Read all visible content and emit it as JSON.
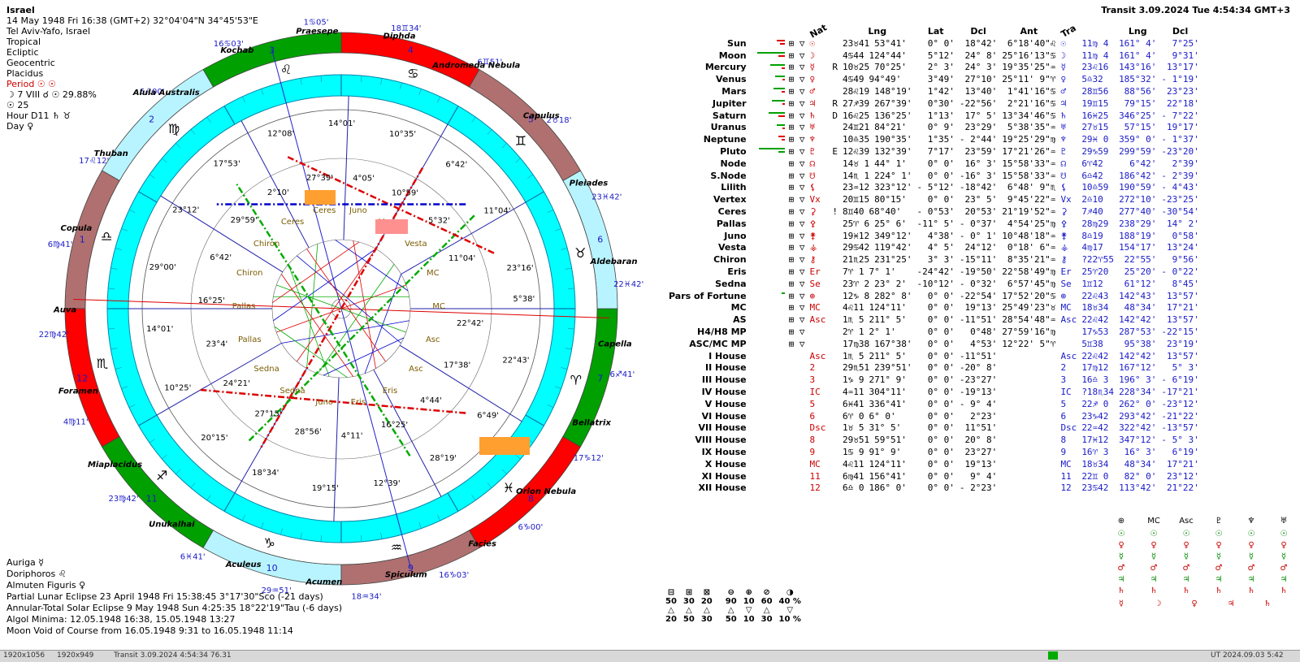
{
  "info": {
    "place": "Israel",
    "datetime": "14 May 1948  Fri  16:38 (GMT+2) 32°04'04\"N  34°45'53\"E",
    "city": "Tel Aviv-Yafo, Israel",
    "zodiac": "Tropical",
    "coords": "Ecliptic",
    "center": "Geocentric",
    "houses": "Placidus",
    "period": "Period  ☉ ☉",
    "moon_phase": "☽  7 VIII ☌ ☉ 29.88%",
    "day_num": "☉  25",
    "hour": "Hour D11  ♄ ♉",
    "day": "Day  ♀"
  },
  "transit": {
    "label": "Transit  3.09.2024   Tue   4:54:34 GMT+3"
  },
  "chart_labels": {
    "house_numbers": [
      "1",
      "2",
      "3",
      "4",
      "5",
      "6",
      "7",
      "8",
      "9",
      "10",
      "11",
      "12"
    ],
    "cusps": [
      "22♓42'",
      "23♓42'",
      "2♉18'",
      "6♊51'",
      "18♊34'",
      "1♋05'",
      "16♋03'",
      "6♌00'",
      "17♌12'",
      "6♍41'",
      "22♍42'",
      "4♍11'",
      "23♍42'",
      "6♓41'",
      "29♒51'",
      "18♒34'",
      "16♑03'",
      "6♑00'",
      "17♑12'",
      "6♐41'"
    ],
    "stars": [
      "Praesepe",
      "Kochab",
      "Alula Australis",
      "Thuban",
      "Copula",
      "Auva",
      "Foramen",
      "Miaplacidus",
      "Unukalhai",
      "Aculeus",
      "Acumen",
      "Spiculum",
      "Facies",
      "Orion Nebula",
      "Bellatrix",
      "Capella",
      "Aldebaran",
      "Pleiades",
      "Capulus",
      "Andromeda Nebula",
      "Diphda"
    ],
    "planet_labels": [
      "23°16'",
      "11°04'",
      "11°04'",
      "5°32'",
      "6°42'",
      "10°59'",
      "10°35'",
      "4°05'",
      "14°01'",
      "27°39'",
      "12°08'",
      "2°10'",
      "17°53'",
      "29°59'",
      "23°12'",
      "6°42'",
      "29°00'",
      "16°25'",
      "14°01'",
      "23°4'",
      "10°25'",
      "24°21'",
      "20°15'",
      "27°15'",
      "18°34'",
      "28°56'",
      "19°15'",
      "4°11'",
      "12°39'",
      "16°25'",
      "28°19'",
      "4°44'",
      "6°49'",
      "17°38'",
      "22°43'",
      "22°42'",
      "5°38'"
    ],
    "point_names": [
      "Vesta",
      "Vesta",
      "Juno",
      "Ceres",
      "Ceres",
      "Chiron",
      "Chiron",
      "Pallas",
      "Pallas",
      "Sedna",
      "Sedna",
      "Juno",
      "Eris",
      "Eris",
      "Asc",
      "Asc",
      "MC",
      "MC"
    ]
  },
  "table_headers": {
    "nat": "Nat",
    "lng": "Lng",
    "lat": "Lat",
    "dcl": "Dcl",
    "ant": "Ant",
    "tra": "Tra",
    "tlng": "Lng",
    "tdcl": "Dcl"
  },
  "rows": [
    {
      "name": "Sun",
      "sym": "☉",
      "flag": "",
      "lng": "23♉41",
      "lngd": "53°41'",
      "lat": "0° 0'",
      "dcl": "18°42'",
      "ant": "6°18'40\"♌",
      "tsym": "☉",
      "tra": "11♍ 4",
      "tlng": "161° 4'",
      "tdcl": "7°25'",
      "bars": [
        [
          "#e00000",
          10
        ],
        [
          "#e00000",
          6
        ]
      ]
    },
    {
      "name": "Moon",
      "sym": "☽",
      "flag": "",
      "lng": "4♋44",
      "lngd": "124°44'",
      "lat": "5°12'",
      "dcl": "24° 8'",
      "ant": "25°16'13\"♋",
      "tsym": "☽",
      "tra": "11♍ 4",
      "tlng": "161° 4'",
      "tdcl": "9°31'",
      "bars": [
        [
          "#00a000",
          34
        ],
        [
          "#e00000",
          8
        ]
      ]
    },
    {
      "name": "Mercury",
      "sym": "☿",
      "flag": "R",
      "lng": "10♉25",
      "lngd": "70°25'",
      "lat": "2° 3'",
      "dcl": "24° 3'",
      "ant": "19°35'25\"♒",
      "tsym": "☿",
      "tra": "23♌16",
      "tlng": "143°16'",
      "tdcl": "13°17'",
      "bars": [
        [
          "#00a000",
          18
        ],
        [
          "#e00000",
          4
        ]
      ]
    },
    {
      "name": "Venus",
      "sym": "♀",
      "flag": "",
      "lng": "4♋49",
      "lngd": "94°49'",
      "lat": "3°49'",
      "dcl": "27°10'",
      "ant": "25°11' 9\"♈",
      "tsym": "♀",
      "tra": "5♎32",
      "tlng": "185°32'",
      "tdcl": "- 1°19'",
      "bars": [
        [
          "#00a000",
          12
        ],
        [
          "#e00000",
          3
        ]
      ]
    },
    {
      "name": "Mars",
      "sym": "♂",
      "flag": "",
      "lng": "28♌19",
      "lngd": "148°19'",
      "lat": "1°42'",
      "dcl": "13°40'",
      "ant": "1°41'16\"♋",
      "tsym": "♂",
      "tra": "28♊56",
      "tlng": "88°56'",
      "tdcl": "23°23'",
      "bars": [
        [
          "#00a000",
          14
        ],
        [
          "#e00000",
          4
        ]
      ]
    },
    {
      "name": "Jupiter",
      "sym": "♃",
      "flag": "R",
      "lng": "27♐39",
      "lngd": "267°39'",
      "lat": "0°30'",
      "dcl": "-22°56'",
      "ant": "2°21'16\"♋",
      "tsym": "♃",
      "tra": "19♊15",
      "tlng": "79°15'",
      "tdcl": "22°18'",
      "bars": [
        [
          "#00a000",
          16
        ],
        [
          "#e00000",
          3
        ]
      ]
    },
    {
      "name": "Saturn",
      "sym": "♄",
      "flag": "D",
      "lng": "16♌25",
      "lngd": "136°25'",
      "lat": "1°13'",
      "dcl": "17° 5'",
      "ant": "13°34'46\"♋",
      "tsym": "♄",
      "tra": "16♓25",
      "tlng": "346°25'",
      "tdcl": "- 7°22'",
      "bars": [
        [
          "#00a000",
          20
        ],
        [
          "#e00000",
          8
        ]
      ]
    },
    {
      "name": "Uranus",
      "sym": "♅",
      "flag": "",
      "lng": "24♊21",
      "lngd": "84°21'",
      "lat": "0° 9'",
      "dcl": "23°29'",
      "ant": "5°38'35\"♒",
      "tsym": "♅",
      "tra": "27♉15",
      "tlng": "57°15'",
      "tdcl": "19°17'",
      "bars": [
        [
          "#00a000",
          10
        ],
        [
          "#e00000",
          3
        ]
      ]
    },
    {
      "name": "Neptune",
      "sym": "♆",
      "flag": "",
      "lng": "10♎35",
      "lngd": "190°35'",
      "lat": "1°35'",
      "dcl": "- 2°44'",
      "ant": "19°25'29\"♍",
      "tsym": "♆",
      "tra": "29♓ 0",
      "tlng": "359° 0'",
      "tdcl": "- 1°37'",
      "bars": [
        [
          "#e00000",
          8
        ],
        [
          "#e00000",
          4
        ]
      ]
    },
    {
      "name": "Pluto",
      "sym": "♇",
      "flag": "E",
      "lng": "12♌39",
      "lngd": "132°39'",
      "lat": "7°17'",
      "dcl": "23°59'",
      "ant": "17°21'26\"♒",
      "tsym": "♇",
      "tra": "29♑59",
      "tlng": "299°59'",
      "tdcl": "-23°20'",
      "bars": [
        [
          "#00a000",
          32
        ],
        [
          "#00a000",
          8
        ]
      ]
    },
    {
      "name": "Node",
      "sym": "☊",
      "flag": "",
      "lng": "14♉ 1",
      "lngd": "44° 1'",
      "lat": "0° 0'",
      "dcl": "16° 3'",
      "ant": "15°58'33\"♒",
      "tsym": "☊",
      "tra": "6♈42",
      "tlng": "6°42'",
      "tdcl": "2°39'",
      "bars": []
    },
    {
      "name": "S.Node",
      "sym": "☋",
      "flag": "",
      "lng": "14♏ 1",
      "lngd": "224° 1'",
      "lat": "0° 0'",
      "dcl": "-16° 3'",
      "ant": "15°58'33\"♒",
      "tsym": "☋",
      "tra": "6♎42",
      "tlng": "186°42'",
      "tdcl": "- 2°39'",
      "bars": []
    },
    {
      "name": "Lilith",
      "sym": "⚸",
      "flag": "",
      "lng": "23♒12",
      "lngd": "323°12'",
      "lat": "- 5°12'",
      "dcl": "-18°42'",
      "ant": "6°48' 9\"♏",
      "tsym": "⚸",
      "tra": "10♎59",
      "tlng": "190°59'",
      "tdcl": "- 4°43'",
      "bars": []
    },
    {
      "name": "Vertex",
      "sym": "Vx",
      "flag": "",
      "lng": "20♊15",
      "lngd": "80°15'",
      "lat": "0° 0'",
      "dcl": "23° 5'",
      "ant": "9°45'22\"♒",
      "tsym": "Vx",
      "tra": "2♎10",
      "tlng": "272°10'",
      "tdcl": "-23°25'",
      "bars": []
    },
    {
      "name": "Ceres",
      "sym": "⚳",
      "flag": "!",
      "lng": "8♊40",
      "lngd": "68°40'",
      "lat": "- 0°53'",
      "dcl": "20°53'",
      "ant": "21°19'52\"♒",
      "tsym": "⚳",
      "tra": "7♐40",
      "tlng": "277°40'",
      "tdcl": "-30°54'",
      "bars": []
    },
    {
      "name": "Pallas",
      "sym": "⚴",
      "flag": "",
      "lng": "25♈ 6",
      "lngd": "25° 6'",
      "lat": "-11° 5'",
      "dcl": "- 0°37'",
      "ant": "4°54'25\"♍",
      "tsym": "⚴",
      "tra": "28♍29",
      "tlng": "238°29'",
      "tdcl": "14° 2'",
      "bars": []
    },
    {
      "name": "Juno",
      "sym": "⚵",
      "flag": "",
      "lng": "19♓12",
      "lngd": "349°12'",
      "lat": "4°38'",
      "dcl": "- 0° 1'",
      "ant": "10°48'18\"♒",
      "tsym": "⚵",
      "tra": "8♎19",
      "tlng": "188°19'",
      "tdcl": "0°58'",
      "bars": []
    },
    {
      "name": "Vesta",
      "sym": "⚶",
      "flag": "",
      "lng": "29♋42",
      "lngd": "119°42'",
      "lat": "4° 5'",
      "dcl": "24°12'",
      "ant": "0°18' 6\"♒",
      "tsym": "⚶",
      "tra": "4♍17",
      "tlng": "154°17'",
      "tdcl": "13°24'",
      "bars": []
    },
    {
      "name": "Chiron",
      "sym": "⚷",
      "flag": "",
      "lng": "21♏25",
      "lngd": "231°25'",
      "lat": "3° 3'",
      "dcl": "-15°11'",
      "ant": "8°35'21\"♒",
      "tsym": "⚷",
      "tra": "?22♈55",
      "tlng": "22°55'",
      "tdcl": "9°56'",
      "bars": []
    },
    {
      "name": "Eris",
      "sym": "Er",
      "flag": "",
      "lng": "7♈ 1",
      "lngd": "7° 1'",
      "lat": "-24°42'",
      "dcl": "-19°50'",
      "ant": "22°58'49\"♍",
      "tsym": "Er",
      "tra": "25♈20",
      "tlng": "25°20'",
      "tdcl": "- 0°22'",
      "bars": []
    },
    {
      "name": "Sedna",
      "sym": "Se",
      "flag": "",
      "lng": "23♈ 2",
      "lngd": "23° 2'",
      "lat": "-10°12'",
      "dcl": "- 0°32'",
      "ant": "6°57'45\"♍",
      "tsym": "Se",
      "tra": "1♊12",
      "tlng": "61°12'",
      "tdcl": "8°45'",
      "bars": []
    },
    {
      "name": "Pars of Fortune",
      "sym": "⊕",
      "flag": "",
      "lng": "12♑ 8",
      "lngd": "282° 8'",
      "lat": "0° 0'",
      "dcl": "-22°54'",
      "ant": "17°52'20\"♋",
      "tsym": "⊕",
      "tra": "22♌43",
      "tlng": "142°43'",
      "tdcl": "13°57'",
      "bars": [
        [
          "#00a000",
          4
        ]
      ]
    },
    {
      "name": "MC",
      "sym": "MC",
      "flag": "",
      "lng": "4♌11",
      "lngd": "124°11'",
      "lat": "0° 0'",
      "dcl": "19°13'",
      "ant": "25°49'23\"♉",
      "tsym": "MC",
      "tra": "18♉34",
      "tlng": "48°34'",
      "tdcl": "17°21'",
      "bars": []
    },
    {
      "name": "AS",
      "sym": "Asc",
      "flag": "",
      "lng": "1♏ 5",
      "lngd": "211° 5'",
      "lat": "0° 0'",
      "dcl": "-11°51'",
      "ant": "28°54'48\"♒",
      "tsym": "Asc",
      "tra": "22♌42",
      "tlng": "142°42'",
      "tdcl": "13°57'",
      "bars": []
    },
    {
      "name": "H4/H8 MP",
      "sym": "",
      "flag": "",
      "lng": "2♈ 1",
      "lngd": "2° 1'",
      "lat": "0° 0'",
      "dcl": "0°48'",
      "ant": "27°59'16\"♍",
      "tsym": "",
      "tra": "17♑53",
      "tlng": "287°53'",
      "tdcl": "-22°15'",
      "bars": []
    },
    {
      "name": "ASC/MC MP",
      "sym": "",
      "flag": "",
      "lng": "17♍38",
      "lngd": "167°38'",
      "lat": "0° 0'",
      "dcl": "4°53'",
      "ant": "12°22' 5\"♈",
      "tsym": "",
      "tra": "5♊38",
      "tlng": "95°38'",
      "tdcl": "23°19'",
      "bars": []
    }
  ],
  "houses": [
    {
      "name": "I House",
      "sym": "Asc",
      "lng": "1♏ 5",
      "lngd": "211° 5'",
      "lat": "0° 0'",
      "dcl": "-11°51'",
      "tsym": "Asc",
      "tra": "22♌42",
      "tlng": "142°42'",
      "tdcl": "13°57'"
    },
    {
      "name": "II House",
      "sym": "2",
      "lng": "29♏51",
      "lngd": "239°51'",
      "lat": "0° 0'",
      "dcl": "-20° 8'",
      "tsym": "2",
      "tra": "17♍12",
      "tlng": "167°12'",
      "tdcl": "5° 3'"
    },
    {
      "name": "III House",
      "sym": "3",
      "lng": "1♑ 9",
      "lngd": "271° 9'",
      "lat": "0° 0'",
      "dcl": "-23°27'",
      "tsym": "3",
      "tra": "16♎ 3",
      "tlng": "196° 3'",
      "tdcl": "- 6°19'"
    },
    {
      "name": "IV House",
      "sym": "IC",
      "lng": "4♒11",
      "lngd": "304°11'",
      "lat": "0° 0'",
      "dcl": "-19°13'",
      "tsym": "IC",
      "tra": "?18♏34",
      "tlng": "228°34'",
      "tdcl": "-17°21'"
    },
    {
      "name": "V House",
      "sym": "5",
      "lng": "6♓41",
      "lngd": "336°41'",
      "lat": "0° 0'",
      "dcl": "- 9° 4'",
      "tsym": "5",
      "tra": "22♐ 0",
      "tlng": "262° 0'",
      "tdcl": "-23°12'"
    },
    {
      "name": "VI House",
      "sym": "6",
      "lng": "6♈ 0",
      "lngd": "6° 0'",
      "lat": "0° 0'",
      "dcl": "2°23'",
      "tsym": "6",
      "tra": "23♑42",
      "tlng": "293°42'",
      "tdcl": "-21°22'"
    },
    {
      "name": "VII House",
      "sym": "Dsc",
      "lng": "1♉ 5",
      "lngd": "31° 5'",
      "lat": "0° 0'",
      "dcl": "11°51'",
      "tsym": "Dsc",
      "tra": "22♒42",
      "tlng": "322°42'",
      "tdcl": "-13°57'"
    },
    {
      "name": "VIII House",
      "sym": "8",
      "lng": "29♉51",
      "lngd": "59°51'",
      "lat": "0° 0'",
      "dcl": "20° 8'",
      "tsym": "8",
      "tra": "17♓12",
      "tlng": "347°12'",
      "tdcl": "- 5° 3'"
    },
    {
      "name": "IX House",
      "sym": "9",
      "lng": "1♋ 9",
      "lngd": "91° 9'",
      "lat": "0° 0'",
      "dcl": "23°27'",
      "tsym": "9",
      "tra": "16♈ 3",
      "tlng": "16° 3'",
      "tdcl": "6°19'"
    },
    {
      "name": "X House",
      "sym": "MC",
      "lng": "4♌11",
      "lngd": "124°11'",
      "lat": "0° 0'",
      "dcl": "19°13'",
      "tsym": "MC",
      "tra": "18♉34",
      "tlng": "48°34'",
      "tdcl": "17°21'"
    },
    {
      "name": "XI House",
      "sym": "11",
      "lng": "6♍41",
      "lngd": "156°41'",
      "lat": "0° 0'",
      "dcl": "9° 4'",
      "tsym": "11",
      "tra": "22♊ 0",
      "tlng": "82° 0'",
      "tdcl": "23°12'"
    },
    {
      "name": "XII House",
      "sym": "12",
      "lng": "6♎ 0",
      "lngd": "186° 0'",
      "lat": "0° 0'",
      "dcl": "- 2°23'",
      "tsym": "12",
      "tra": "23♋42",
      "tlng": "113°42'",
      "tdcl": "21°22'"
    }
  ],
  "bottom_info": [
    "Auriga  ☿",
    "Doriphoros  ♌",
    "Almuten Figuris  ♀",
    "Partial Lunar Eclipse 23 April 1948 Fri 15:38:45  3°17'30\"Sco (-21 days)",
    "Annular-Total Solar Eclipse 9 May 1948 Sun  4:25:35 18°22'19\"Tau (-6 days)",
    "Algol Minima: 12.05.1948 16:38,  15.05.1948 13:27",
    "Moon Void of Course from 16.05.1948  9:31 to 16.05.1948 11:14"
  ],
  "stats": {
    "row1": [
      "50",
      "30",
      "20",
      "",
      "90",
      "10",
      "60",
      "40 %"
    ],
    "row2": [
      "20",
      "50",
      "30",
      "",
      "50",
      "10",
      "30",
      "10 %"
    ]
  },
  "status": {
    "left": "1920x1056",
    "mid": "1920x949",
    "transit": "Transit  3.09.2024  4:54:34  76.31",
    "right": "UT  2024.09.03  5:42"
  },
  "colors": {
    "cyan": "#00ffff",
    "red": "#ff0000",
    "green": "#00a000",
    "brown": "#b07070",
    "lightcyan": "#b8f4ff",
    "blue": "#1a1ac8",
    "orange": "#ff9f30",
    "pink": "#ff9090"
  }
}
